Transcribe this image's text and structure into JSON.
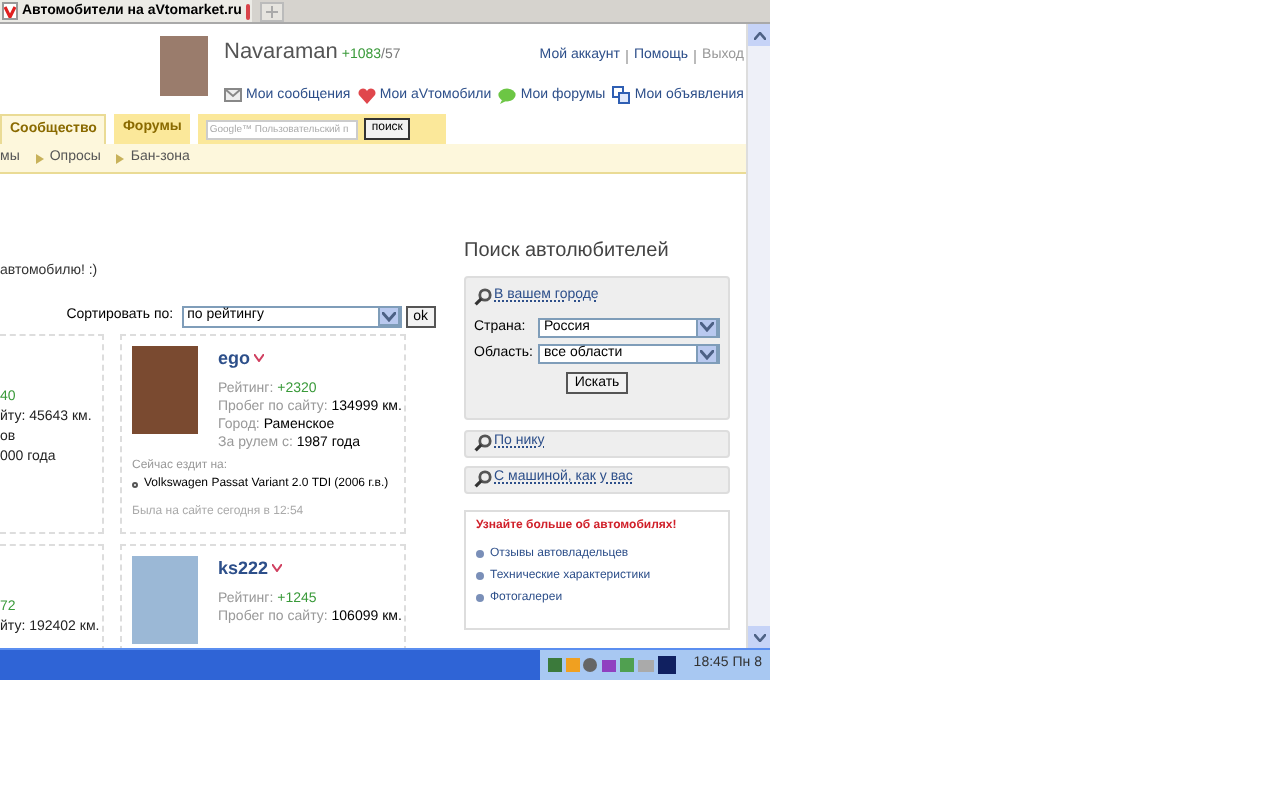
{
  "browser_tab": {
    "title": "Автомобители на aVtomarket.ru"
  },
  "user": {
    "name": "Navaraman",
    "rating": "+1083",
    "count": "/57"
  },
  "account_links": [
    "Мой аккаунт",
    "Помощь",
    "Выход"
  ],
  "quick_links": [
    {
      "label": "Мои сообщения",
      "kind": "mail"
    },
    {
      "label": "Мои aVтомобили",
      "kind": "heart"
    },
    {
      "label": "Мои форумы",
      "kind": "chat"
    },
    {
      "label": "Мои объявления",
      "kind": "ads"
    }
  ],
  "tabs": [
    {
      "label": "Сообщество",
      "selected": true
    },
    {
      "label": "Форумы",
      "selected": false
    }
  ],
  "search": {
    "placeholder": "Google™ Пользовательский п",
    "button": "поиск"
  },
  "subnav": [
    "мы",
    "Опросы",
    "Бан-зона"
  ],
  "intro": "автомобилю! :)",
  "sort": {
    "label": "Сортировать по:",
    "value": "по рейтингу",
    "button": "ok"
  },
  "cut_cards": [
    {
      "lines": [
        {
          "text": "40",
          "kind": "rating"
        },
        {
          "text": "йту: 45643 км.",
          "kind": "plain"
        },
        {
          "text": "ов",
          "kind": "plain"
        },
        {
          "text": "000 года",
          "kind": "plain"
        }
      ]
    },
    {
      "lines": [
        {
          "text": "72",
          "kind": "rating"
        },
        {
          "text": "йту: 192402 км.",
          "kind": "plain"
        }
      ]
    }
  ],
  "cards": [
    {
      "nick": "ego",
      "kind": "person",
      "rating_label": "Рейтинг:",
      "rating": "+2320",
      "mileage_label": "Пробег по сайту:",
      "mileage": "134999 км.",
      "city_label": "Город:",
      "city": "Раменское",
      "since_label": "За рулем с:",
      "since": "1987 года",
      "drives_label": "Сейчас ездит на:",
      "car": "Volkswagen Passat Variant 2.0 TDI (2006 г.в.)",
      "last_seen": "Была на сайте сегодня в 12:54"
    },
    {
      "nick": "ks222",
      "kind": "tree",
      "rating_label": "Рейтинг:",
      "rating": "+1245",
      "mileage_label": "Пробег по сайту:",
      "mileage": "106099 км."
    }
  ],
  "finder": {
    "title": "Поиск автолюбителей",
    "city_link": "В вашем городе",
    "country_label": "Страна:",
    "country": "Россия",
    "region_label": "Область:",
    "region": "все области",
    "button": "Искать",
    "nick_link": "По нику",
    "car_link": "С машиной, как у вас"
  },
  "info": {
    "title": "Узнайте больше об автомобилях!",
    "items": [
      "Отзывы автовладельцев",
      "Технические характеристики",
      "Фотогалереи"
    ]
  },
  "tray": {
    "clock": "18:45 Пн 8"
  }
}
